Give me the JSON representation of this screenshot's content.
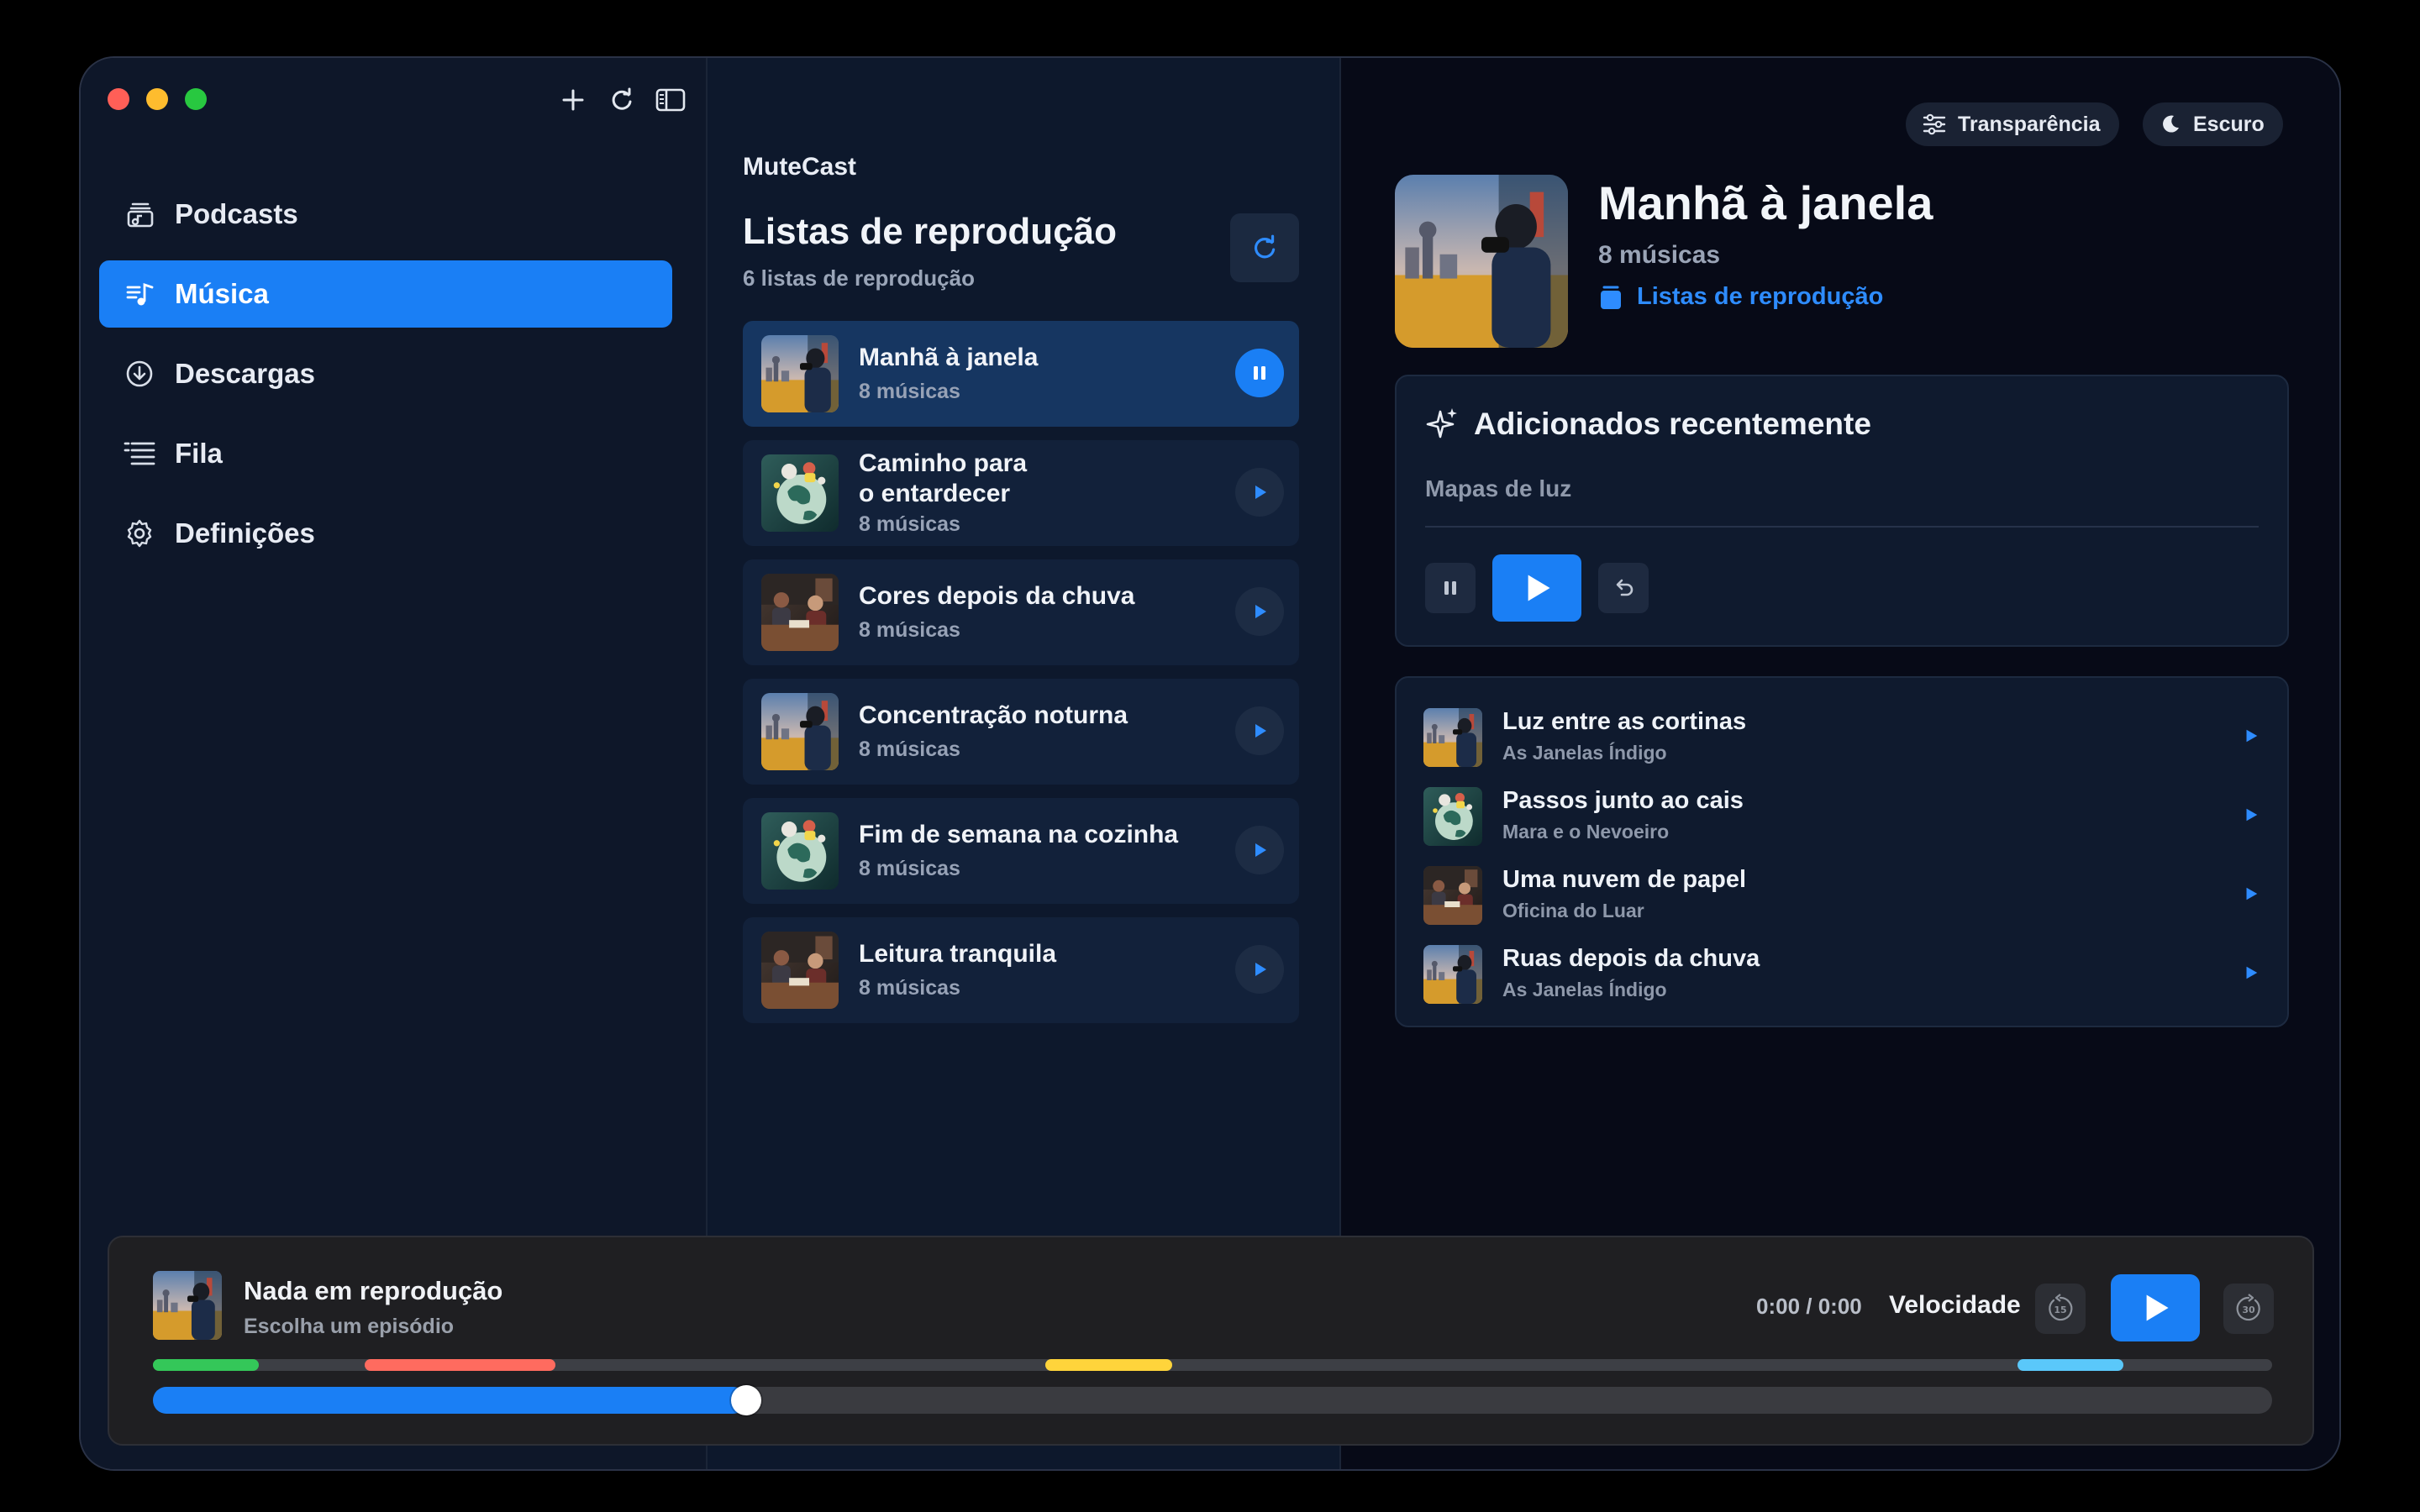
{
  "app": {
    "name": "MuteCast"
  },
  "sidebar": {
    "items": [
      {
        "label": "Podcasts",
        "icon": "podcasts-icon",
        "active": false
      },
      {
        "label": "Música",
        "icon": "music-icon",
        "active": true
      },
      {
        "label": "Descargas",
        "icon": "download-icon",
        "active": false
      },
      {
        "label": "Fila",
        "icon": "queue-icon",
        "active": false
      },
      {
        "label": "Definições",
        "icon": "gear-icon",
        "active": false
      }
    ]
  },
  "playlists": {
    "title": "Listas de reprodução",
    "count": "6 listas de reprodução",
    "items": [
      {
        "name": "Manhã à janela",
        "sub": "8 músicas",
        "playing": true
      },
      {
        "name_line1": "Caminho para",
        "name_line2": "o entardecer",
        "sub": "8 músicas",
        "playing": false
      },
      {
        "name": "Cores depois da chuva",
        "sub": "8 músicas",
        "playing": false
      },
      {
        "name": "Concentração noturna",
        "sub": "8 músicas",
        "playing": false
      },
      {
        "name": "Fim de semana na cozinha",
        "sub": "8 músicas",
        "playing": false
      },
      {
        "name": "Leitura tranquila",
        "sub": "8 músicas",
        "playing": false
      }
    ]
  },
  "detail": {
    "transparency_label": "Transparência",
    "dark_label": "Escuro",
    "title": "Manhã à janela",
    "count": "8 músicas",
    "link": "Listas de reprodução",
    "recent": {
      "title": "Adicionados recentemente",
      "subtitle": "Mapas de luz"
    },
    "tracks": [
      {
        "name": "Luz entre as cortinas",
        "artist": "As Janelas Índigo"
      },
      {
        "name": "Passos junto ao cais",
        "artist": "Mara e o Nevoeiro"
      },
      {
        "name": "Uma nuvem de papel",
        "artist": "Oficina do Luar"
      },
      {
        "name": "Ruas depois da chuva",
        "artist": "As Janelas Índigo"
      }
    ]
  },
  "player": {
    "title": "Nada em reprodução",
    "subtitle": "Escolha um episódio",
    "time": "0:00 / 0:00",
    "speed_label": "Velocidade",
    "skip_back_label": "15",
    "skip_fwd_label": "30",
    "progress_fraction": 0.28,
    "chapter_segments": [
      {
        "start": 0.0,
        "end": 0.05,
        "color": "#34c759"
      },
      {
        "start": 0.1,
        "end": 0.19,
        "color": "#ff6b5f"
      },
      {
        "start": 0.421,
        "end": 0.481,
        "color": "#ffd43b"
      },
      {
        "start": 0.88,
        "end": 0.93,
        "color": "#5ac8fa"
      }
    ]
  },
  "colors": {
    "accent": "#1a7ff5"
  }
}
